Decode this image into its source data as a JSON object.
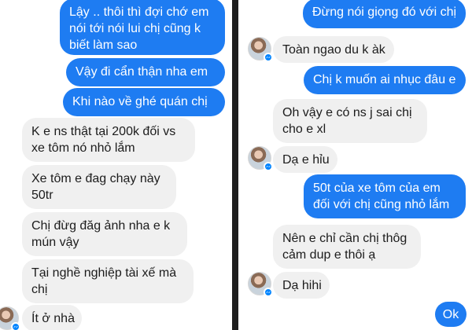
{
  "left": {
    "messages": [
      {
        "dir": "out",
        "lines": [
          "Lậy .. thôi thì đợi chớ em",
          "nói tới nói lui chị cũng k",
          "biết làm sao"
        ]
      },
      {
        "dir": "out",
        "lines": [
          "Vậy đi cẩn thận nha em"
        ]
      },
      {
        "dir": "out",
        "lines": [
          "Khi nào về ghé quán chị"
        ]
      },
      {
        "dir": "in",
        "lines": [
          "K e ns thật tại 200k đối vs",
          "xe tôm nó nhỏ lắm"
        ]
      },
      {
        "dir": "in",
        "lines": [
          "Xe tôm e đag chạy này",
          "50tr"
        ]
      },
      {
        "dir": "in",
        "lines": [
          "Chị đừg đăg ảnh nha e k",
          "mún vậy"
        ]
      },
      {
        "dir": "in",
        "lines": [
          "Tại nghề nghiệp tài xế mà",
          "chị"
        ]
      },
      {
        "dir": "in",
        "lines": [
          "Ít ở nhà"
        ]
      }
    ]
  },
  "right": {
    "messages": [
      {
        "dir": "out",
        "lines": [
          "Đừng nói giọng đó với chị"
        ]
      },
      {
        "dir": "in",
        "lines": [
          "Toàn ngao du k àk"
        ]
      },
      {
        "dir": "out",
        "lines": [
          "Chị k muốn ai nhục đâu e"
        ]
      },
      {
        "dir": "in",
        "lines": [
          "Oh vậy e có ns j sai chị",
          "cho e xl"
        ]
      },
      {
        "dir": "in",
        "lines": [
          "Dạ e hỉu"
        ]
      },
      {
        "dir": "out",
        "lines": [
          "50t của xe tôm của em",
          "đối với chị cũng nhỏ lắm"
        ]
      },
      {
        "dir": "in",
        "lines": [
          "Nên e chỉ cần chị thôg",
          "cảm dup e thôi ạ"
        ]
      },
      {
        "dir": "in",
        "lines": [
          "Dạ hihi"
        ]
      },
      {
        "dir": "out",
        "lines": [
          "Ok"
        ]
      }
    ]
  },
  "icons": {
    "avatar": "contact-avatar",
    "badge": "messenger-badge-icon"
  },
  "colors": {
    "outgoing_bubble": "#1e7cf2",
    "incoming_bubble": "#f0f0f0",
    "panel_background": "#ffffff",
    "divider": "#1e1e1e"
  }
}
